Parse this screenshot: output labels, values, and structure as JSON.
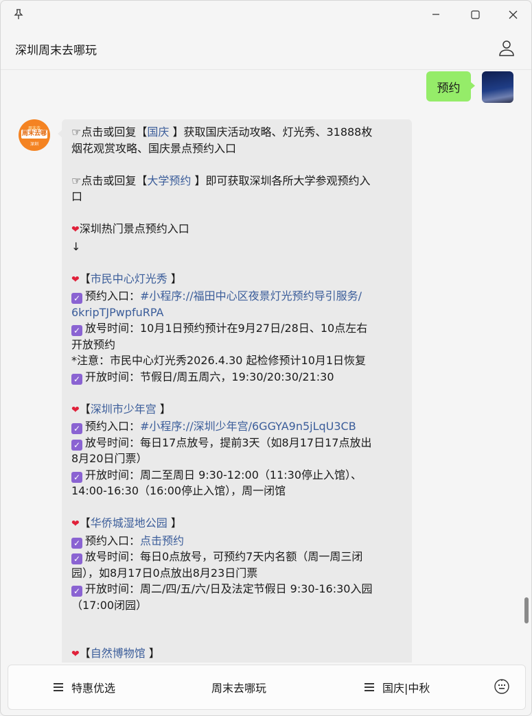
{
  "window": {
    "controls": [
      "minimize",
      "maximize",
      "close"
    ],
    "pin_icon": "pin-icon"
  },
  "header": {
    "title": "深圳周末去哪玩",
    "profile_icon": "person-icon"
  },
  "messages": {
    "outgoing": {
      "text": "预约"
    },
    "bot_avatar": {
      "line1": "周末去",
      "line2": "周末去哪",
      "line3": "深圳"
    },
    "incoming": {
      "p1_a": "☞点击或回复【",
      "p1_link": "国庆",
      "p1_b": " 】获取国庆活动攻略、灯光秀、31888枚",
      "p1_c": "烟花观赏攻略、国庆景点预约入口",
      "p2_a": "☞点击或回复【",
      "p2_link": "大学预约",
      "p2_b": " 】即可获取深圳各所大学参观预约入",
      "p2_c": "口",
      "p3": "深圳热门景点预约入口",
      "arrow": "↓",
      "s1_title": "市民中心灯光秀",
      "s1_book_label": "预约入口：",
      "s1_book_link_a": "#小程序://福田中心区夜景灯光预约导引服务/",
      "s1_book_link_b": "6kripTJPwpfuRPA",
      "s1_release_a": "放号时间：10月1日预约预计在9月27日/28日、10点左右",
      "s1_release_b": "开放预约",
      "s1_note": "*注意：市民中心灯光秀2026.4.30 起检修预计10月1日恢复",
      "s1_open": "开放时间：节假日/周五周六，19:30/20:30/21:30",
      "s2_title": "深圳市少年宫",
      "s2_book_label": "预约入口：",
      "s2_book_link": "#小程序://深圳少年宫/6GGYA9n5jLqU3CB",
      "s2_release_a": "放号时间：每日17点放号，提前3天（如8月17日17点放出",
      "s2_release_b": "8月20日门票）",
      "s2_open_a": "开放时间：周二至周日 9:30-12:00（11:30停止入馆）、",
      "s2_open_b": "14:00-16:30（16:00停止入馆），周一闭馆",
      "s3_title": "华侨城湿地公园",
      "s3_book_label": "预约入口：",
      "s3_book_link": "点击预约",
      "s3_release_a": "放号时间：每日0点放号，可预约7天内名额（周一周三闭",
      "s3_release_b": "园），如8月17日0点放出8月23日门票",
      "s3_open_a": "开放时间：周二/四/五/六/日及法定节假日 9:30-16:30入园",
      "s3_open_b": "（17:00闭园）",
      "s4_title": "自然博物馆",
      "bracket_open": "【",
      "bracket_close": " 】"
    }
  },
  "bottom_menu": {
    "item1": "特惠优选",
    "item2": "周末去哪玩",
    "item3": "国庆|中秋",
    "keyboard_icon": "keyboard-icon"
  }
}
